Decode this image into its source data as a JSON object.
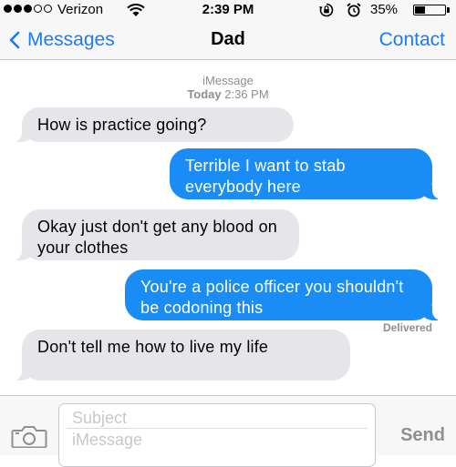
{
  "status_bar": {
    "carrier": "Verizon",
    "time": "2:39 PM",
    "battery_percent": "35%",
    "battery_level": 0.35,
    "icons": [
      "signal-dots-icon",
      "wifi-icon",
      "rotation-lock-icon",
      "alarm-icon",
      "battery-icon"
    ]
  },
  "nav": {
    "back_label": "Messages",
    "title": "Dad",
    "contact_label": "Contact"
  },
  "thread": {
    "service": "iMessage",
    "day": "Today",
    "time": "2:36 PM"
  },
  "messages": [
    {
      "direction": "incoming",
      "text": "How is practice going?"
    },
    {
      "direction": "outgoing",
      "text": "Terrible I want to stab everybody here"
    },
    {
      "direction": "incoming",
      "text": "Okay just don't get any blood on your clothes"
    },
    {
      "direction": "outgoing",
      "text": "You're a police officer you shouldn't be codoning this"
    },
    {
      "direction": "incoming",
      "text": "Don't tell me how to live my life"
    }
  ],
  "delivered_label": "Delivered",
  "compose": {
    "subject_placeholder": "Subject",
    "message_placeholder": "iMessage",
    "send_label": "Send"
  },
  "colors": {
    "ios_blue": "#1a7cf9",
    "outgoing_bubble": "#1a8cf6",
    "incoming_bubble": "#e5e5ea"
  }
}
